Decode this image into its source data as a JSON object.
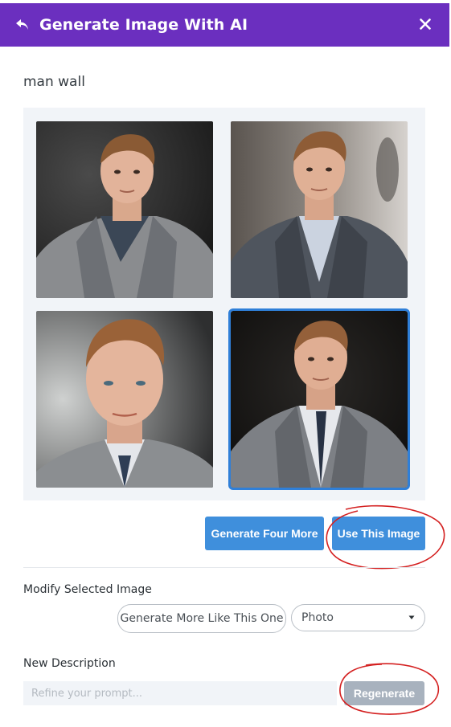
{
  "header": {
    "title": "Generate Image With AI"
  },
  "prompt": "man wall",
  "gallery": {
    "images": [
      {
        "label": "man portrait 1",
        "selected": false
      },
      {
        "label": "man portrait 2",
        "selected": false
      },
      {
        "label": "man portrait 3",
        "selected": false
      },
      {
        "label": "man portrait 4",
        "selected": true
      }
    ]
  },
  "actions": {
    "generate_four_more": "Generate Four More",
    "use_this_image": "Use This Image"
  },
  "modify": {
    "label": "Modify Selected Image",
    "generate_more_like": "Generate More Like This One",
    "style_select": "Photo"
  },
  "new_description": {
    "label": "New Description",
    "placeholder": "Refine your prompt...",
    "regenerate": "Regenerate"
  },
  "colors": {
    "header": "#6b2fbf",
    "button": "#3f8fdc",
    "regenerate": "#a8b2be",
    "selection": "#2f7fd8",
    "annotation": "#d42020"
  }
}
